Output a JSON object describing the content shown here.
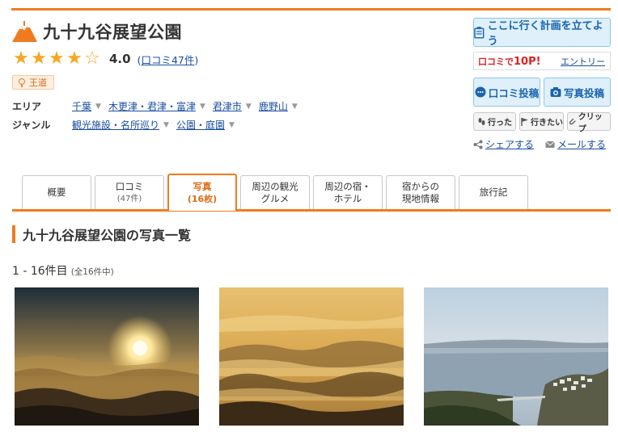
{
  "header": {
    "title": "九十九谷展望公園",
    "rating": 4.0,
    "rating_text": "4.0",
    "review_link": "口コミ47件",
    "badge": "王道",
    "area_label": "エリア",
    "area_items": [
      "千葉",
      "木更津・君津・富津",
      "君津市",
      "鹿野山"
    ],
    "genre_label": "ジャンル",
    "genre_items": [
      "観光施設・名所巡り",
      "公園・庭園"
    ]
  },
  "actions": {
    "plan_button": "ここに行く計画を立てよう",
    "points_prefix": "口コミで",
    "points_value": "10P!",
    "entry_link": "エントリー",
    "review_post": "口コミ投稿",
    "photo_post": "写真投稿",
    "went": "行った",
    "want": "行きたい",
    "clip": "クリップ",
    "share": "シェアする",
    "mail": "メールする"
  },
  "tabs": [
    {
      "label": "概要",
      "sub": ""
    },
    {
      "label": "口コミ",
      "sub": "(47件)"
    },
    {
      "label": "写真",
      "sub": "(16枚)",
      "active": true
    },
    {
      "label": "周辺の観光",
      "sub": "グルメ"
    },
    {
      "label": "周辺の宿・",
      "sub": "ホテル"
    },
    {
      "label": "宿からの",
      "sub": "現地情報"
    },
    {
      "label": "旅行記",
      "sub": ""
    }
  ],
  "section_title": "九十九谷展望公園の写真一覧",
  "results": {
    "range": "1 - 16件目",
    "total": "(全16件中)"
  },
  "photos": [
    {
      "subject": "sunrise over sea of clouds"
    },
    {
      "subject": "golden mist over mountain ridges"
    },
    {
      "subject": "coastal town and bay view"
    }
  ],
  "colors": {
    "accent": "#f07b1f",
    "link": "#1a4fa0",
    "button_bg": "#dff0fb",
    "star": "#f5a623"
  }
}
